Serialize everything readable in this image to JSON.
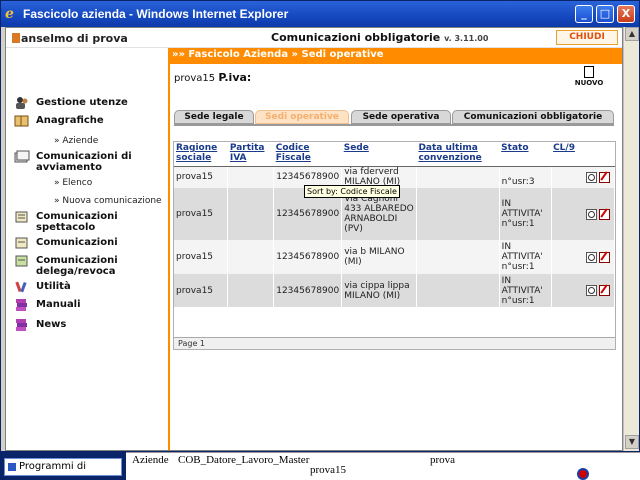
{
  "window": {
    "title": "Fascicolo azienda - Windows Internet Explorer",
    "minimize": "_",
    "maximize": "□",
    "close": "X"
  },
  "header": {
    "user": "anselmo di prova",
    "app_title": "Comunicazioni obbligatorie",
    "version": "v. 3.11.00",
    "close_label": "CHIUDI"
  },
  "breadcrumb": "»» Fascicolo Azienda » Sedi operative",
  "sidebar": {
    "items": [
      {
        "label": "Gestione utenze",
        "icon": "users-icon"
      },
      {
        "label": "Anagrafiche",
        "icon": "book-icon"
      },
      {
        "label": "Comunicazioni di",
        "label2": "avviamento",
        "icon": "forms-icon"
      },
      {
        "label": "Comunicazioni",
        "label2": "spettacolo",
        "icon": "spectacle-icon"
      },
      {
        "label": "Comunicazioni",
        "icon": "communications-icon"
      },
      {
        "label": "Comunicazioni",
        "label2": "delega/revoca",
        "icon": "delegation-icon"
      },
      {
        "label": "Utilità",
        "icon": "tools-icon"
      },
      {
        "label": "Manuali",
        "icon": "manuals-icon"
      },
      {
        "label": "News",
        "icon": "news-icon"
      }
    ],
    "subitems": {
      "aziende": "» Aziende",
      "elenco": "» Elenco",
      "nuova": "» Nuova comunicazione"
    }
  },
  "company": {
    "name": "prova15",
    "piva_label": "P.iva:"
  },
  "nuovo_label": "NUOVO",
  "tabs": [
    {
      "label": "Sede legale",
      "active": false
    },
    {
      "label": "Sedi operative",
      "active": true
    },
    {
      "label": "Sede operativa",
      "active": false
    },
    {
      "label": "Comunicazioni obbligatorie",
      "active": false
    }
  ],
  "table": {
    "headers": [
      "Ragione sociale",
      "Partita IVA",
      "Codice Fiscale",
      "Sede",
      "Data ultima convenzione",
      "Stato",
      "CL/9"
    ],
    "rows": [
      {
        "ragione": "prova15",
        "piva": "",
        "cf": "12345678900",
        "sede": "via fderverd MILANO  (MI)",
        "data": "",
        "stato": "n°usr:3"
      },
      {
        "ragione": "prova15",
        "piva": "",
        "cf": "12345678900",
        "sede": "Via Cagnoni 433 ALBAREDO ARNABOLDI  (PV)",
        "data": "",
        "stato": "IN ATTIVITA' n°usr:1"
      },
      {
        "ragione": "prova15",
        "piva": "",
        "cf": "12345678900",
        "sede": "via b MILANO  (MI)",
        "data": "",
        "stato": "IN ATTIVITA' n°usr:1"
      },
      {
        "ragione": "prova15",
        "piva": "",
        "cf": "12345678900",
        "sede": "via cippa lippa MILANO  (MI)",
        "data": "",
        "stato": "IN ATTIVITA' n°usr:1"
      }
    ],
    "pager": "Page 1"
  },
  "tooltip": "Sort by: Codice Fiscale",
  "background": {
    "taskbar_item": "Programmi di",
    "row": [
      "Aziende",
      "COB_Datore_Lavoro_Master",
      "prova15",
      "prova"
    ]
  },
  "colors": {
    "accent": "#ff8c00",
    "titlebar": "#1548c0",
    "link": "#1a3a8a"
  }
}
